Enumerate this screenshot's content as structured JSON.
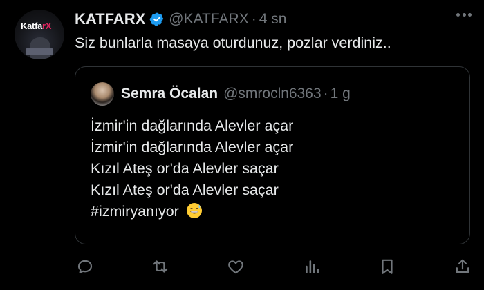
{
  "post": {
    "display_name": "KATFARX",
    "handle": "@KATFARX",
    "separator": "·",
    "time": "4 sn",
    "text": "Siz bunlarla masaya oturdunuz, pozlar verdiniz..",
    "avatar_logo": {
      "prefix": "Kat",
      "mid": "fa",
      "accent": "rX"
    }
  },
  "quote": {
    "display_name": "Semra Öcalan",
    "handle": "@smrocln6363",
    "separator": "·",
    "time": "1 g",
    "lines": [
      "İzmir'in dağlarında Alevler açar",
      "İzmir'in dağlarında Alevler açar",
      "Kızıl Ateş or'da Alevler saçar",
      "Kızıl Ateş or'da Alevler saçar"
    ],
    "hashtag": "#izmiryanıyor"
  },
  "icons": {
    "verified": "verified-badge-icon",
    "more": "more-options-icon",
    "reply": "reply-icon",
    "repost": "repost-icon",
    "like": "like-icon",
    "views": "views-icon",
    "bookmark": "bookmark-icon",
    "share": "share-icon"
  },
  "colors": {
    "background": "#000000",
    "text": "#e7e9ea",
    "muted": "#71767b",
    "border": "#2f3336",
    "verified": "#1d9bf0"
  }
}
